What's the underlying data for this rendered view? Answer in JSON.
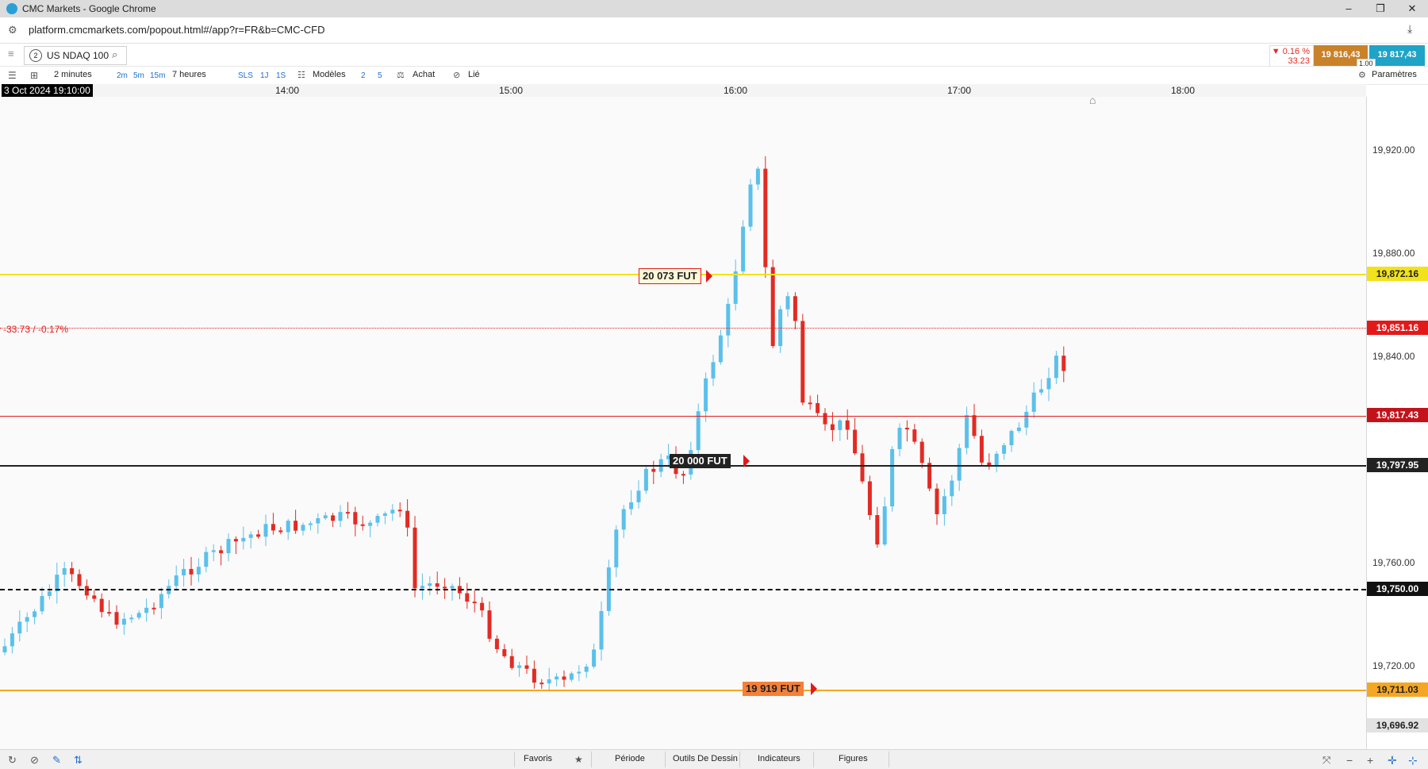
{
  "window": {
    "title": "CMC Markets - Google Chrome"
  },
  "browser": {
    "url": "platform.cmcmarkets.com/popout.html#/app?r=FR&b=CMC-CFD"
  },
  "instrument": {
    "badge": "2",
    "name": "US NDAQ 100",
    "change_pct": "▼ 0.16 %",
    "change_abs": "33.23",
    "sell_price": "19 816,43",
    "buy_price": "19 817,43",
    "spread": "1.00"
  },
  "toolbar": {
    "interval": "2 minutes",
    "quick_intervals": [
      "2m",
      "5m",
      "15m"
    ],
    "range": "7 heures",
    "sls": "SLS",
    "one_day": "1J",
    "one_sec": "1S",
    "templates": "Modèles",
    "n2": "2",
    "n5": "5",
    "buy": "Achat",
    "linked": "Lié",
    "settings": "Paramètres"
  },
  "time_axis": {
    "current": "3 Oct 2024 19:10:00",
    "labels": [
      "14:00",
      "15:00",
      "16:00",
      "17:00",
      "18:00"
    ]
  },
  "price_axis": {
    "ticks": [
      "19,920.00",
      "19,880.00",
      "19,840.00",
      "19,760.00",
      "19,720.00"
    ]
  },
  "markers": {
    "change_text": "-33.73 / -0.17%",
    "levels": [
      {
        "label": "19,872.16",
        "value": 19872.16,
        "color": "#f1e21b",
        "text_color": "#222"
      },
      {
        "label": "19,851.16",
        "value": 19851.16,
        "color": "#e31919",
        "text_color": "#fff"
      },
      {
        "label": "19,817.43",
        "value": 19817.43,
        "color": "#c4121a",
        "text_color": "#fff"
      },
      {
        "label": "19,797.95",
        "value": 19797.95,
        "color": "#222222",
        "text_color": "#fff"
      },
      {
        "label": "19,750.00",
        "value": 19750.0,
        "color": "#111111",
        "text_color": "#fff"
      },
      {
        "label": "19,711.03",
        "value": 19711.03,
        "color": "#f5a623",
        "text_color": "#222"
      },
      {
        "label": "19,696.92",
        "value": 19696.92,
        "color": "#e2e2e2",
        "text_color": "#222"
      }
    ],
    "futures": [
      {
        "label": "20 073 FUT"
      },
      {
        "label": "20 000 FUT"
      },
      {
        "label": "19 919 FUT"
      }
    ]
  },
  "bottom_tabs": [
    "Favoris",
    "Période",
    "Outils De Dessin",
    "Indicateurs",
    "Figures"
  ],
  "colors": {
    "up": "#5bc0eb",
    "down": "#e22b23",
    "accent": "#1f6fd1"
  }
}
